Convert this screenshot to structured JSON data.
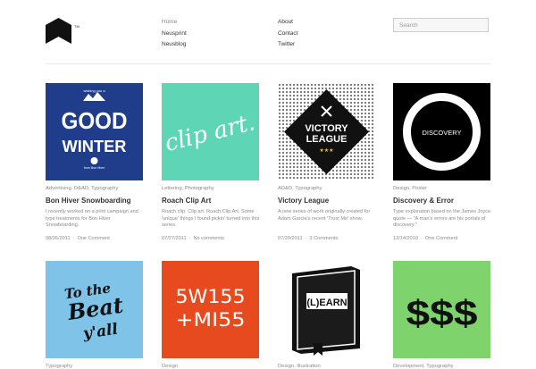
{
  "logo": {
    "alt": "logo",
    "tm": "TM"
  },
  "nav": {
    "col1": [
      {
        "label": "Home",
        "active": true
      },
      {
        "label": "Neusprint"
      },
      {
        "label": "Neusblog"
      }
    ],
    "col2": [
      {
        "label": "About"
      },
      {
        "label": "Contact"
      },
      {
        "label": "Twitter"
      }
    ]
  },
  "search": {
    "placeholder": "Search"
  },
  "cards": [
    {
      "cats": "Advertising, D&AD, Typography",
      "title": "Bon Hiver Snowboarding",
      "desc": "I recently worked on a print campaign and type treatments for Bon Hiver Snowboarding.",
      "date": "08/26/2011",
      "comments": "One Comment",
      "art": {
        "top": "wishing you a",
        "big1": "GOOD",
        "big2": "WINTER",
        "foot": "from Bon Hiver"
      }
    },
    {
      "cats": "Lettering, Photography",
      "title": "Roach Clip Art",
      "desc": "Roach clip. Clip art. Roach Clip Art. Some 'unique' things I found pickin' turned into this series.",
      "date": "07/27/2011",
      "comments": "No comments",
      "art": {
        "text": "clip art."
      }
    },
    {
      "cats": "AD&D, Typography",
      "title": "Victory League",
      "desc": "A new series of work originally created for Adam Garcia's recent 'Trust Me' show.",
      "date": "07/20/2011",
      "comments": "3 Comments",
      "art": {
        "line1": "VICTORY",
        "line2": "LEAGUE",
        "stars": "★★★"
      }
    },
    {
      "cats": "Design, Poster",
      "title": "Discovery & Error",
      "desc": "Type exploration based on the James Joyce quote — \"A man's errors are his portals of discovery.\"",
      "date": "12/14/2010",
      "comments": "One Comment",
      "art": {
        "text": "DISCOVERY"
      }
    },
    {
      "cats": "Typography",
      "title": "",
      "desc": "",
      "date": "",
      "comments": "",
      "art": {
        "l1": "To the",
        "l2": "Beat",
        "l3": "y'all"
      }
    },
    {
      "cats": "Design",
      "title": "",
      "desc": "",
      "date": "",
      "comments": "",
      "art": {
        "l1": "5W155",
        "l2": "+MI55"
      }
    },
    {
      "cats": "Design, Illustration",
      "title": "",
      "desc": "",
      "date": "",
      "comments": "",
      "art": {
        "text": "(L)EARN"
      }
    },
    {
      "cats": "Development, Typography",
      "title": "",
      "desc": "",
      "date": "",
      "comments": "",
      "art": {
        "text": "$$$"
      }
    }
  ],
  "colors": {
    "navy": "#1f3d8a",
    "mint": "#5ed6b6",
    "red": "#e84a1f",
    "blue": "#7fc3e8",
    "green": "#7fd36c"
  }
}
